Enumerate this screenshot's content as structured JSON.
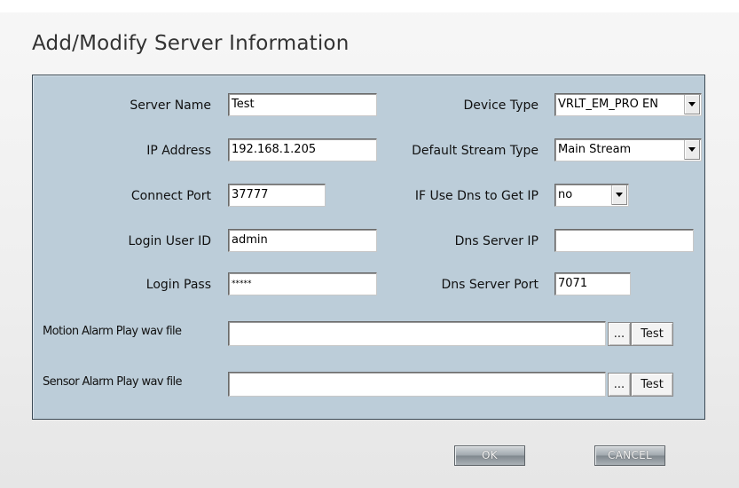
{
  "dialog": {
    "title": "Add/Modify Server Information"
  },
  "fields": {
    "server_name": {
      "label": "Server Name",
      "value": "Test"
    },
    "ip_address": {
      "label": "IP Address",
      "value": "192.168.1.205"
    },
    "connect_port": {
      "label": "Connect Port",
      "value": "37777"
    },
    "login_user_id": {
      "label": "Login User ID",
      "value": "admin"
    },
    "login_pass": {
      "label": "Login Pass",
      "value": "*****"
    },
    "device_type": {
      "label": "Device Type",
      "value": "VRLT_EM_PRO EN"
    },
    "default_stream_type": {
      "label": "Default Stream Type",
      "value": "Main Stream"
    },
    "use_dns": {
      "label": "IF Use Dns to Get IP",
      "value": "no"
    },
    "dns_server_ip": {
      "label": "Dns Server IP",
      "value": ""
    },
    "dns_server_port": {
      "label": "Dns Server Port",
      "value": "7071"
    },
    "motion_alarm_wav": {
      "label": "Motion Alarm Play wav file",
      "value": ""
    },
    "sensor_alarm_wav": {
      "label": "Sensor Alarm Play wav file",
      "value": ""
    }
  },
  "buttons": {
    "browse": "...",
    "test": "Test",
    "ok": "OK",
    "cancel": "CANCEL"
  }
}
